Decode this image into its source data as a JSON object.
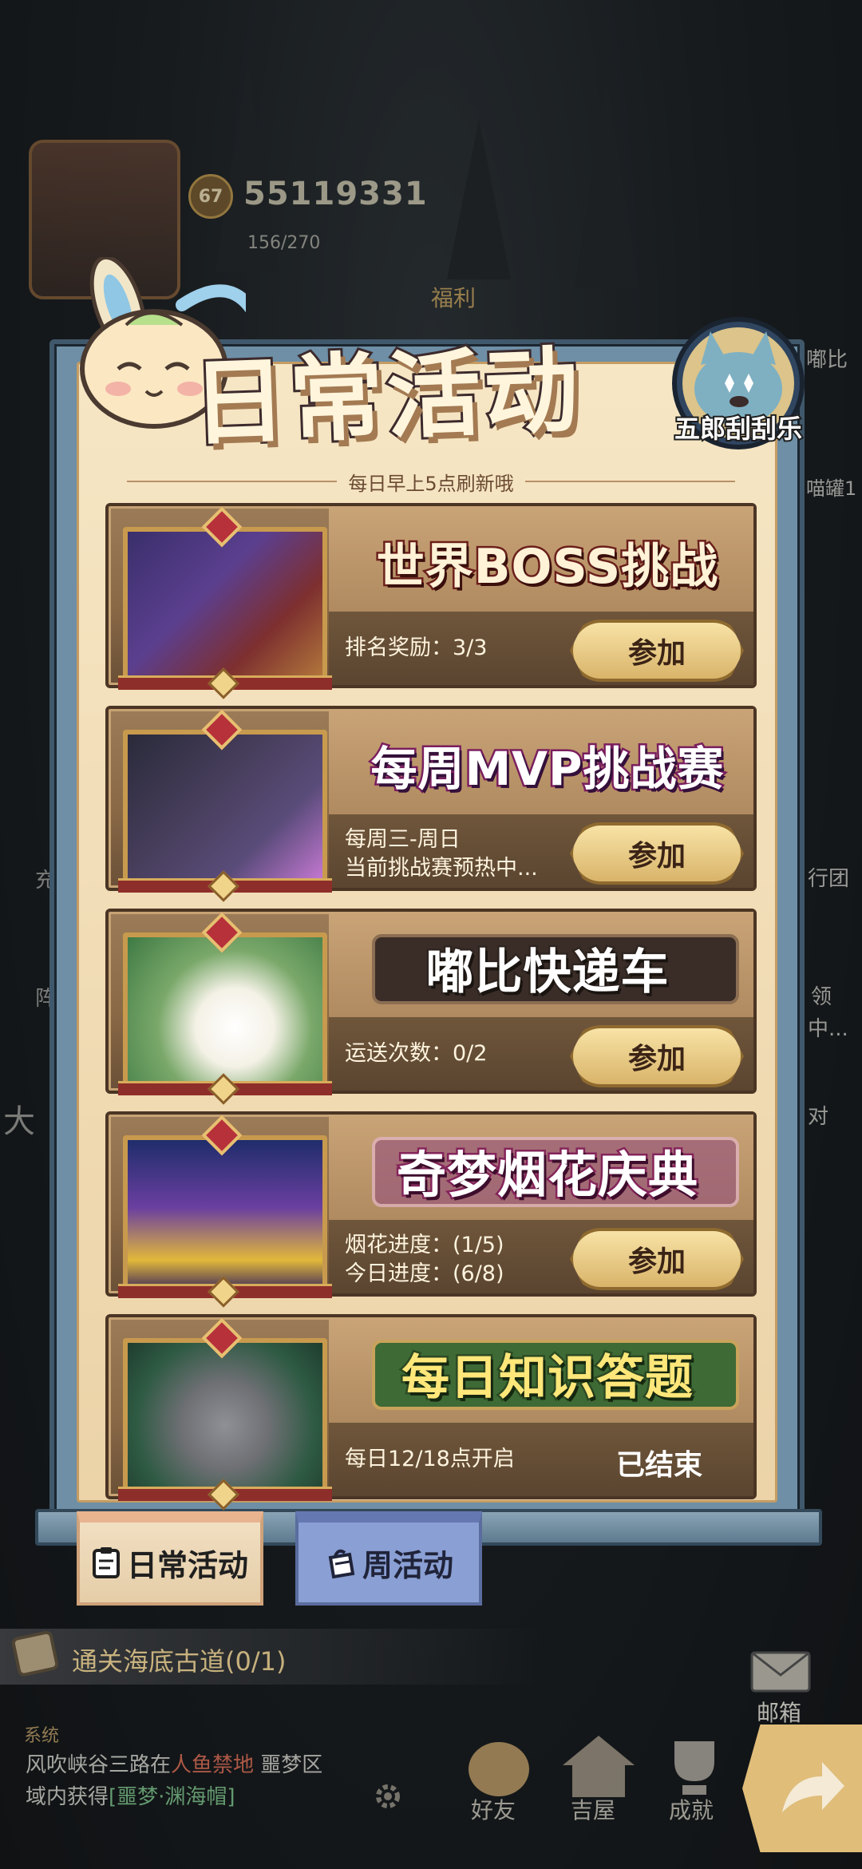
{
  "hud": {
    "level": "67",
    "power": "55119331",
    "energy": "156/270",
    "fuli_label": "福利",
    "left_labels": [
      "充",
      "阵"
    ],
    "right_labels": [
      "嘟比",
      "喵罐1",
      "行团",
      "领",
      "中...",
      "对"
    ],
    "left_edge_char": "大"
  },
  "panel": {
    "title": "日常活动",
    "subtitle": "每日早上5点刷新哦",
    "corner_avatar_label": "五郎刮刮乐"
  },
  "events": [
    {
      "title": "世界BOSS挑战",
      "info_lines": [
        "排名奖励：3/3"
      ],
      "action": "参加",
      "thumb_palette": [
        "#3a2f6b",
        "#7d2f2f",
        "#b47a3c"
      ]
    },
    {
      "title": "每周MVP挑战赛",
      "info_lines": [
        "每周三-周日",
        "当前挑战赛预热中..."
      ],
      "action": "参加",
      "thumb_palette": [
        "#2a2a3a",
        "#5a4c7a",
        "#c97ad6"
      ]
    },
    {
      "title": "嘟比快递车",
      "info_lines": [
        "运送次数：0/2"
      ],
      "action": "参加",
      "thumb_palette": [
        "#7aa86a",
        "#ffffff",
        "#3e7a44"
      ]
    },
    {
      "title": "奇梦烟花庆典",
      "info_lines": [
        "烟花进度：(1/5)",
        "今日进度：(6/8)"
      ],
      "action": "参加",
      "thumb_palette": [
        "#1f2d6b",
        "#e2b83a",
        "#6a3fa0"
      ]
    },
    {
      "title": "每日知识答题",
      "info_lines": [
        "每日12/18点开启"
      ],
      "status": "已结束",
      "thumb_palette": [
        "#2e5a43",
        "#6d6f73",
        "#e6c23a"
      ]
    }
  ],
  "tabs": {
    "daily": "日常活动",
    "weekly": "周活动"
  },
  "bottom": {
    "quest": "通关海底古道(0/1)",
    "chat_tag": "系统",
    "chat_line1_a": "风吹峡谷三路在",
    "chat_line1_b": "人鱼禁地",
    "chat_line1_c": " 噩梦区",
    "chat_line2_a": "域内获得",
    "chat_line2_b": "[噩梦·渊海帽]",
    "nav": [
      "好友",
      "吉屋",
      "成就"
    ],
    "mail": "邮箱"
  },
  "colors": {
    "panel_frame": "#6e8fa6",
    "parchment": "#f3dfbc",
    "button": "#e6c57e",
    "card_dark": "#5b4530"
  }
}
